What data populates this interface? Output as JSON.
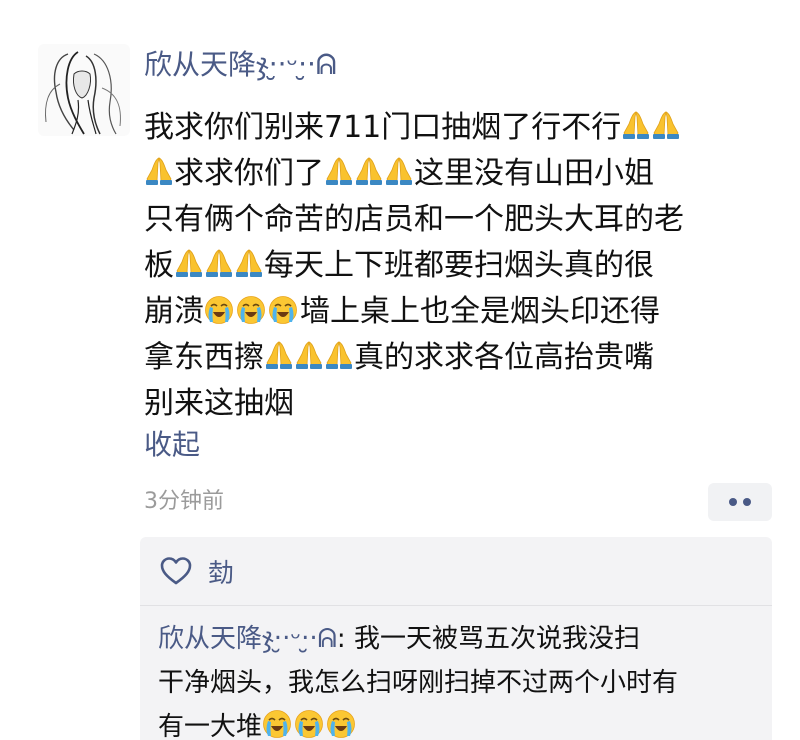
{
  "post": {
    "author": "欣从天降ჯ‧̮‧ᵕ‧̮‧ᕱ",
    "text_lines": [
      {
        "a": "我求你们别来711门口抽烟了行不行",
        "b": ""
      },
      {
        "a": "求求你们了",
        "b": "这里没有山田小姐"
      },
      {
        "a": "只有俩个命苦的店员和一个肥头大耳的老",
        "b": ""
      },
      {
        "a": "板",
        "b": "每天上下班都要扫烟头真的很"
      },
      {
        "a": "崩溃",
        "b": "墙上桌上也全是烟头印还得"
      },
      {
        "a": "拿东西擦",
        "b": "真的求求各位高抬贵嘴"
      },
      {
        "a": "别来这抽烟",
        "b": ""
      }
    ],
    "collapse_label": "收起",
    "time": "3分钟前",
    "emoji": {
      "pray": "pray-emoji",
      "cry": "loudly-crying-emoji"
    }
  },
  "interactions": {
    "likes": "勎",
    "comment": {
      "author": "欣从天降ჯ‧̮‧ᵕ‧̮‧ᕱ",
      "separator": ": ",
      "line1_text": "我一天被骂五次说我没扫",
      "line2_text": "干净烟头，我怎么扫呀刚扫掉不过两个小时有",
      "line3_text": "有一大堆"
    }
  },
  "colors": {
    "link": "#4a5a86",
    "muted": "#9b9b9b",
    "panel_bg": "#f3f3f5"
  }
}
